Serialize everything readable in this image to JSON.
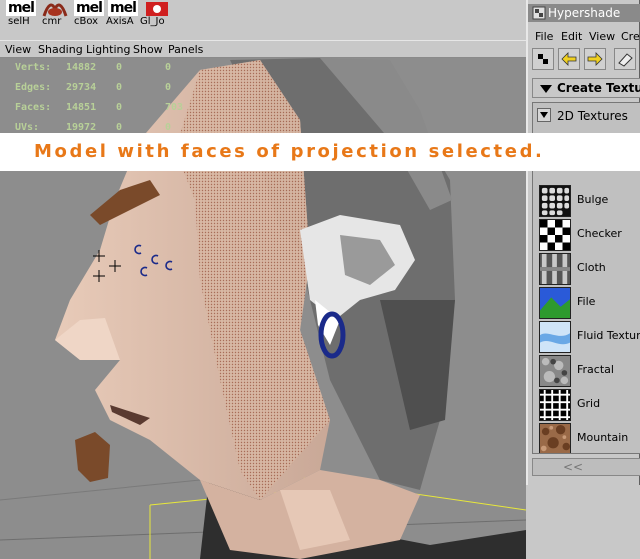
{
  "shelf": {
    "buttons": [
      {
        "icon": "mel",
        "label": "selH"
      },
      {
        "icon": "lamp-icon",
        "label": "cmr"
      },
      {
        "icon": "mel",
        "label": "cBox"
      },
      {
        "icon": "mel",
        "label": "AxisA"
      },
      {
        "icon": "gl-icon",
        "label": "Gl_Jo"
      }
    ],
    "mel_text": "mel"
  },
  "viewport_menu": [
    "View",
    "Shading",
    "Lighting",
    "Show",
    "Panels"
  ],
  "hud": {
    "rows": [
      {
        "label": "Verts:",
        "v1": "14882",
        "v2": "0",
        "v3": "0"
      },
      {
        "label": "Edges:",
        "v1": "29734",
        "v2": "0",
        "v3": "0"
      },
      {
        "label": "Faces:",
        "v1": "14851",
        "v2": "0",
        "v3": "703"
      },
      {
        "label": "UVs:",
        "v1": "19972",
        "v2": "0",
        "v3": "0"
      }
    ]
  },
  "hypershade": {
    "title": "Hypershade",
    "menu": [
      "File",
      "Edit",
      "View",
      "Crea"
    ],
    "create_label": "Create Texture",
    "section_label": "2D Textures",
    "textures": [
      "Bulge",
      "Checker",
      "Cloth",
      "File",
      "Fluid Texture",
      "Fractal",
      "Grid",
      "Mountain"
    ],
    "scroll_label": "<<"
  },
  "caption": "Model with faces of projection selected."
}
